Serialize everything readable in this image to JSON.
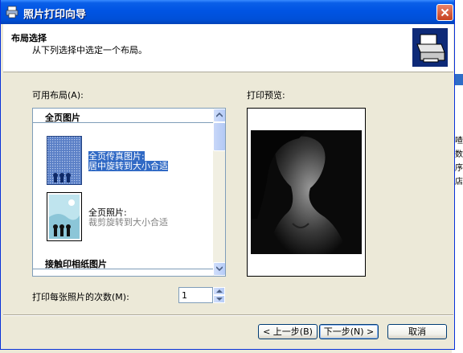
{
  "window": {
    "title": "照片打印向导"
  },
  "header": {
    "title": "布局选择",
    "subtitle": "从下列选择中选定一个布局。"
  },
  "layouts": {
    "label": "可用布局(A):",
    "groups": [
      {
        "name": "全页图片",
        "items": [
          {
            "line1": "全页传真图片:",
            "line2": "居中旋转到大小合适",
            "selected": true
          },
          {
            "line1": "全页照片:",
            "line2": "裁剪旋转到大小合适",
            "selected": false
          }
        ]
      },
      {
        "name": "接触印相纸图片",
        "items": []
      }
    ]
  },
  "preview": {
    "label": "打印预览:"
  },
  "copies": {
    "label": "打印每张照片的次数(M):",
    "value": "1"
  },
  "buttons": {
    "back": "< 上一步(B)",
    "next": "下一步(N) >",
    "cancel": "取消"
  },
  "background_window": {
    "fragments": [
      "喳",
      "数",
      "序",
      "店"
    ]
  },
  "colors": {
    "titlebar": "#0054E3",
    "selection": "#316AC5",
    "face": "#ECE9D8"
  }
}
